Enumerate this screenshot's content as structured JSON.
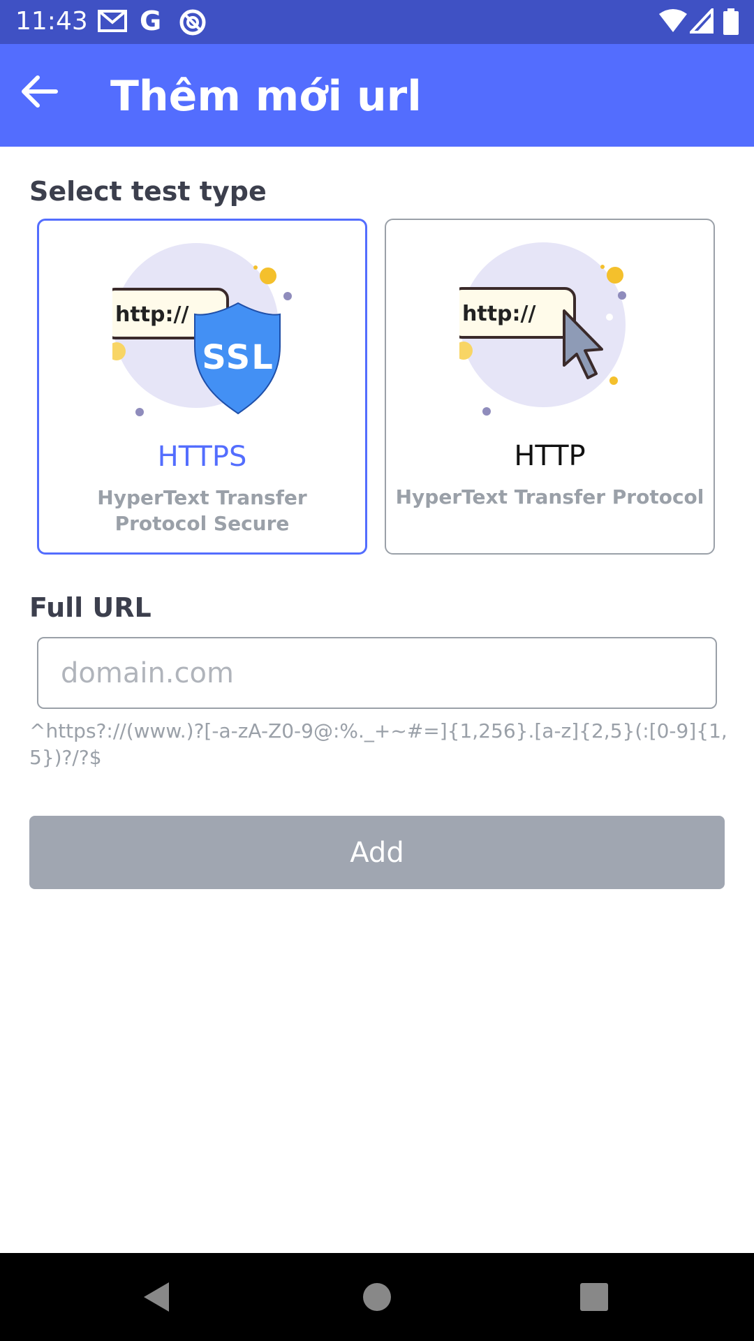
{
  "status_bar": {
    "time": "11:43",
    "icons": [
      "gmail-icon",
      "google-icon",
      "at-sign-icon",
      "wifi-icon",
      "signal-icon",
      "battery-icon"
    ]
  },
  "app_bar": {
    "title": "Thêm mới url",
    "back_icon": "arrow-left-icon"
  },
  "test_type": {
    "label": "Select test type",
    "options": [
      {
        "title": "HTTPS",
        "description": "HyperText Transfer Protocol Secure",
        "badge": "SSL",
        "url_text": "http://",
        "selected": true
      },
      {
        "title": "HTTP",
        "description": "HyperText Transfer Protocol",
        "url_text": "http://",
        "selected": false
      }
    ]
  },
  "url_field": {
    "label": "Full URL",
    "placeholder": "domain.com",
    "value": "",
    "hint": "^https?://(www.)?[-a-zA-Z0-9@:%._+~#=]{1,256}.[a-z]{2,5}(:[0-9]{1,5})?/?$"
  },
  "actions": {
    "add_label": "Add"
  },
  "nav_bar": {
    "icons": [
      "back-triangle-icon",
      "home-circle-icon",
      "recents-square-icon"
    ]
  },
  "colors": {
    "status_bar": "#3f51c4",
    "app_bar": "#536dfe",
    "accent": "#536dfe",
    "button_disabled": "#a0a6b1",
    "muted_text": "#9aa0a8"
  }
}
